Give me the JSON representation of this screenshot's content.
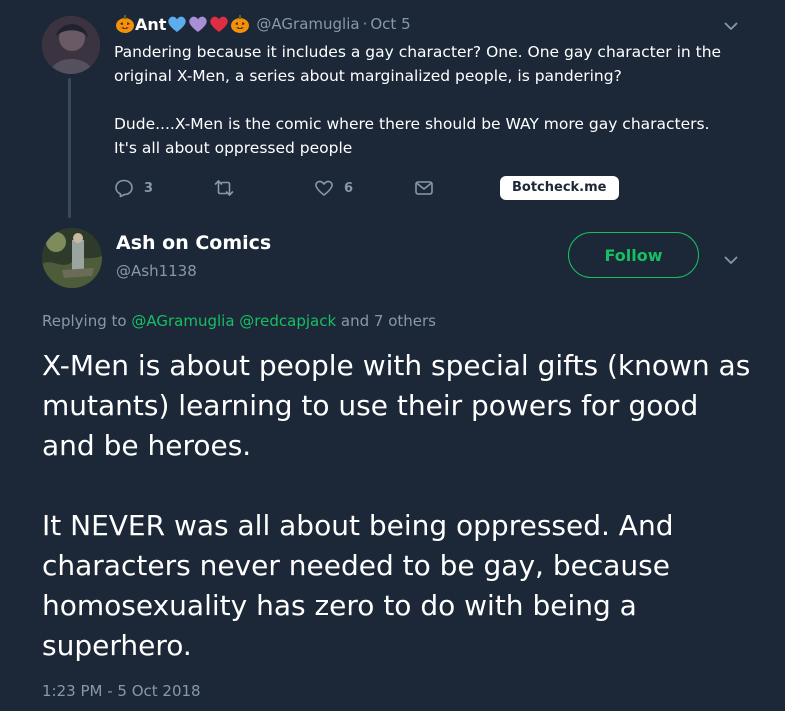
{
  "colors": {
    "background": "#1c2838",
    "accent": "#17bf63",
    "secondary_text": "#8899a6",
    "primary_text": "#ffffff"
  },
  "parent_tweet": {
    "name": "Ant",
    "name_emojis": [
      "pumpkin-emoji",
      "blue-heart-emoji",
      "purple-heart-emoji",
      "red-heart-emoji",
      "pumpkin-emoji"
    ],
    "handle": "@AGramuglia",
    "separator": "·",
    "date": "Oct 5",
    "paragraphs": [
      "Pandering because it includes a gay character? One. One gay character in the original X-Men, a series about marginalized people, is pandering?",
      "Dude....X-Men is the comic where there should be WAY more gay characters. It's all about oppressed people"
    ],
    "reply_count": "3",
    "retweet_count": "",
    "like_count": "6",
    "botcheck_label": "Botcheck.me"
  },
  "main_tweet": {
    "name": "Ash on Comics",
    "handle": "@Ash1138",
    "follow_label": "Follow",
    "replying_prefix": "Replying to",
    "replying_to": [
      "@AGramuglia",
      "@redcapjack"
    ],
    "replying_suffix": "and 7 others",
    "paragraphs": [
      "X-Men is about people with special gifts (known as mutants) learning to use their powers for good and be heroes.",
      "It NEVER was all about being oppressed. And characters never needed to be gay, because homosexuality has zero to do with being a superhero."
    ],
    "timestamp": "1:23 PM - 5 Oct 2018"
  }
}
